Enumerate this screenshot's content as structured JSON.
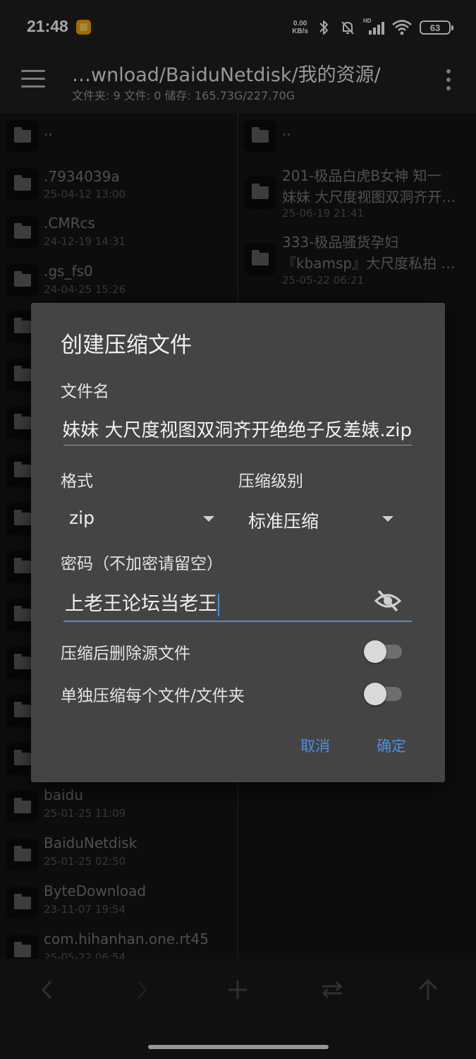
{
  "status_bar": {
    "time": "21:48",
    "net_speed_value": "0.00",
    "net_speed_unit": "KB/s",
    "signal_label": "HD",
    "battery": "63"
  },
  "toolbar": {
    "path": "…wnload/BaiduNetdisk/我的资源/",
    "stats": "文件夹: 9   文件: 0   储存: 165.73G/227.70G"
  },
  "left_pane": {
    "items": [
      {
        "name": "..",
        "date": ""
      },
      {
        "name": ".7934039a",
        "date": "25-04-12 13:00"
      },
      {
        "name": ".CMRcs",
        "date": "24-12-19 14:31"
      },
      {
        "name": ".gs_fs0",
        "date": "24-04-25 15:26"
      },
      {
        "name": "baidu",
        "date": "25-01-25 11:09"
      },
      {
        "name": "BaiduNetdisk",
        "date": "25-01-25 02:50"
      },
      {
        "name": "ByteDownload",
        "date": "23-11-07 19:54"
      },
      {
        "name": "com.hihanhan.one.rt45",
        "date": "25-05-22 06:54"
      }
    ]
  },
  "right_pane": {
    "items": [
      {
        "name": "..",
        "line2": "",
        "date": ""
      },
      {
        "name": "201-极品白虎B女神 知一",
        "line2": "妹妹 大尺度视图双洞齐开绝绝子反差婊",
        "date": "25-06-19 21:41"
      },
      {
        "name": "333-极品骚货孕妇",
        "line2": "『kbamsp』大尺度私拍 流出",
        "date": "25-05-22 06:21"
      }
    ]
  },
  "dialog": {
    "title": "创建压缩文件",
    "filename_label": "文件名",
    "filename_value": "知一妹妹 大尺度视图双洞齐开绝绝子反差婊.zip",
    "format_label": "格式",
    "format_value": "zip",
    "level_label": "压缩级别",
    "level_value": "标准压缩",
    "password_label": "密码（不加密请留空）",
    "password_value": "上老王论坛当老王",
    "delete_source_label": "压缩后删除源文件",
    "delete_source_on": false,
    "separate_label": "单独压缩每个文件/文件夹",
    "separate_on": false,
    "cancel_label": "取消",
    "confirm_label": "确定"
  },
  "colors": {
    "accent": "#4a90e2",
    "dialog_bg": "#444444",
    "background": "#101010"
  }
}
